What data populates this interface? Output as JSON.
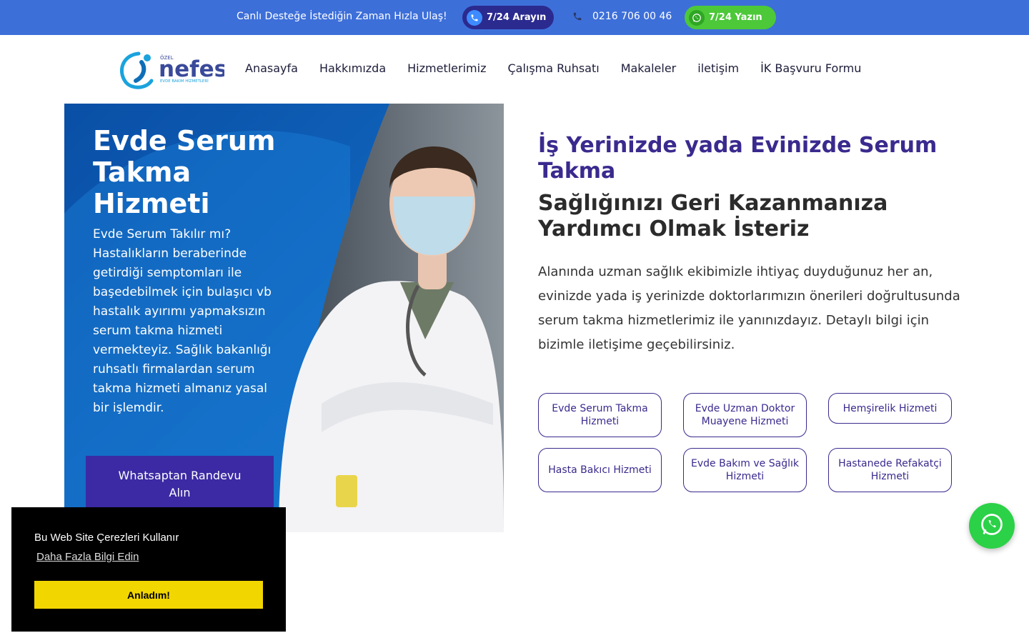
{
  "topbar": {
    "message": "Canlı Desteğe İstediğin Zaman Hızla Ulaş!",
    "call_label": "7/24 Arayın",
    "phone": "0216 706 00 46",
    "whatsapp_label": "7/24 Yazın"
  },
  "logo": {
    "prefix": "ÖZEL",
    "name": "nefes",
    "tagline": "EVDE BAKIM HİZMETLERİ"
  },
  "nav": [
    "Anasayfa",
    "Hakkımızda",
    "Hizmetlerimiz",
    "Çalışma Ruhsatı",
    "Makaleler",
    "iletişim",
    "İK Başvuru Formu"
  ],
  "hero": {
    "title": "Evde Serum Takma Hizmeti",
    "body": "Evde Serum Takılır mı? Hastalıkların beraberinde getirdiği semptomları ile başedebilmek için bulaşıcı vb hastalık ayırımı yapmaksızın serum takma hizmeti vermekteyiz. Sağlık bakanlığı ruhsatlı firmalardan serum takma hizmeti almanız yasal bir işlemdir.",
    "cta": "Whatsaptan Randevu Alın"
  },
  "main": {
    "heading1": "İş Yerinizde yada Evinizde Serum Takma",
    "heading2": "Sağlığınızı Geri Kazanmanıza Yardımcı Olmak İsteriz",
    "description": "Alanında uzman sağlık ekibimizle ihtiyaç duyduğunuz her an, evinizde yada iş yerinizde doktorlarımızın önerileri doğrultusunda serum takma hizmetlerimiz ile yanınızdayız. Detaylı bilgi için bizimle iletişime geçebilirsiniz.",
    "services": [
      "Evde Serum Takma Hizmeti",
      "Evde Uzman Doktor Muayene Hizmeti",
      "Hemşirelik Hizmeti",
      "Hasta Bakıcı Hizmeti",
      "Evde Bakım ve Sağlık Hizmeti",
      "Hastanede Refakatçi Hizmeti"
    ]
  },
  "cookie": {
    "text": "Bu Web Site Çerezleri Kullanır",
    "link": "Daha Fazla Bilgi Edin",
    "button": "Anladım!"
  },
  "colors": {
    "topbar": "#3d6fd9",
    "brand_purple": "#3a2a8e",
    "whatsapp_green": "#2bd147",
    "cookie_button": "#f2d600"
  },
  "icons": [
    "phone-icon",
    "whatsapp-icon"
  ]
}
